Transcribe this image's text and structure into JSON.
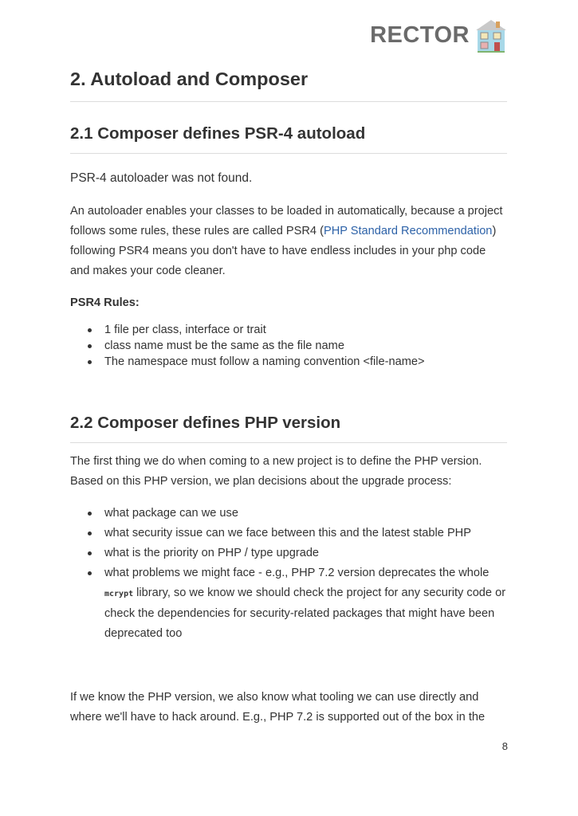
{
  "header": {
    "logo_text": "RECTOR",
    "logo_icon": "house-icon"
  },
  "heading_main": "2. Autoload and Composer",
  "section_21": {
    "title": "2.1 Composer defines PSR-4 autoload",
    "intro": "PSR-4 autoloader was not found.",
    "para_a": "An autoloader enables your classes to be loaded in automatically, because a project follows some rules, these rules are called PSR4 (",
    "link": "PHP Standard Recommendation",
    "para_b": ") following PSR4 means you don't have to have endless includes in your php code and makes your code cleaner.",
    "rules_label": "PSR4 Rules:",
    "rules": [
      "1 file per class, interface or trait",
      "class name must be the same as the file name",
      "The namespace must follow a naming convention <file-name>"
    ]
  },
  "section_22": {
    "title": "2.2 Composer defines PHP version",
    "para": "The first thing we do when coming to a new project is to define the PHP version. Based on this PHP version, we plan decisions about the upgrade process:",
    "items": [
      "what package can we use",
      "what security issue can we face between this and the latest stable PHP",
      "what is the priority on PHP / type upgrade"
    ],
    "item4_a": "what problems we might face - e.g., PHP 7.2 version deprecates the whole ",
    "item4_code": "mcrypt",
    "item4_b": " library, so we know we should check the project for any security code or check the dependencies for security-related packages that might have been deprecated too",
    "closing": "If we know the PHP version, we also know what tooling we can use directly and where we'll have to hack around. E.g., PHP 7.2 is supported out of the box in the"
  },
  "page_number": "8"
}
